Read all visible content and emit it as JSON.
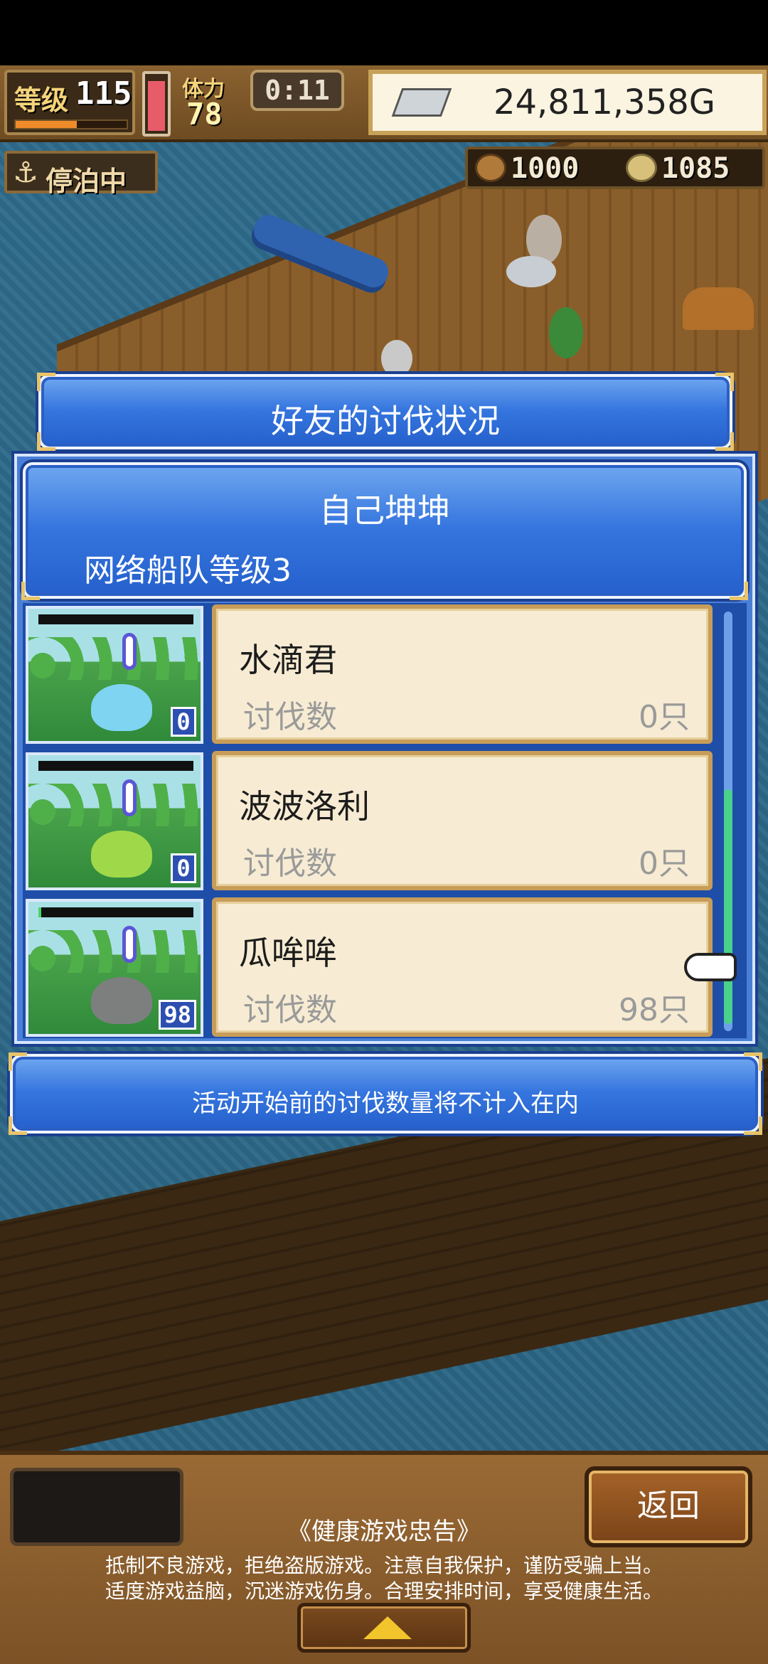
{
  "hud": {
    "level_label": "等级",
    "level_value": "115",
    "level_xp_fraction": 0.55,
    "stamina_fraction": 0.92,
    "stamina_label": "体力",
    "stamina_value": "78",
    "timer": "0:11",
    "money": "24,811,358G",
    "docked_status": "停泊中",
    "resource_1": "1000",
    "resource_2": "1085"
  },
  "dialog": {
    "title": "好友的讨伐状况",
    "friend_name": "自己坤坤",
    "fleet_level": "网络船队等级3",
    "monsters": [
      {
        "name": "水滴君",
        "label": "讨伐数",
        "value": "0只",
        "badge": "0",
        "hp_fraction": 0.0,
        "color": "#7fd4f2"
      },
      {
        "name": "波波洛利",
        "label": "讨伐数",
        "value": "0只",
        "badge": "0",
        "hp_fraction": 0.0,
        "color": "#9fd94a"
      },
      {
        "name": "瓜哞哞",
        "label": "讨伐数",
        "value": "98只",
        "badge": "98",
        "hp_fraction": 0.02,
        "color": "#7d7f7f"
      }
    ],
    "notice": "活动开始前的讨伐数量将不计入在内"
  },
  "footer": {
    "back_label": "返回",
    "advice_title": "《健康游戏忠告》",
    "advice_line1": "抵制不良游戏，拒绝盗版游戏。注意自我保护，谨防受骗上当。",
    "advice_line2": "适度游戏益脑，沉迷游戏伤身。合理安排时间，享受健康生活。"
  },
  "colors": {
    "panel_blue": "#3575de",
    "card_cream": "#f7ecd3",
    "card_border": "#c79d59",
    "back_button": "#a56328"
  }
}
